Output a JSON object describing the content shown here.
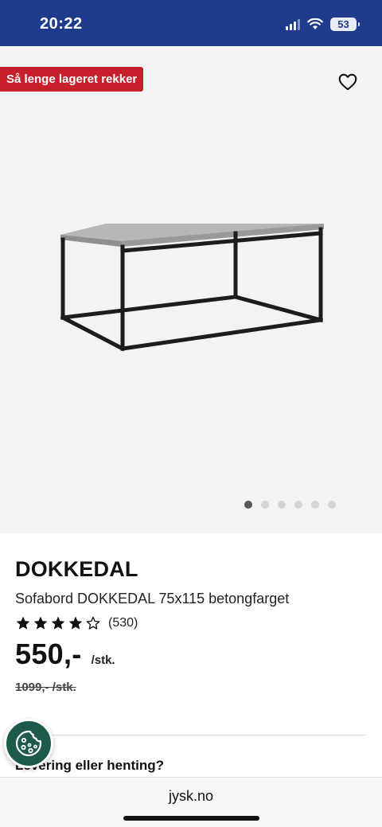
{
  "status_bar": {
    "time": "20:22",
    "battery": "53"
  },
  "badge": {
    "text": "Så lenge lageret rekker"
  },
  "gallery": {
    "slide_count": 6,
    "active_slide": 1
  },
  "product": {
    "brand": "DOKKEDAL",
    "title": "Sofabord DOKKEDAL 75x115 betongfarget",
    "rating": 4,
    "rating_max": 5,
    "review_count": "(530)",
    "price": "550,-",
    "unit": "/stk.",
    "old_price": "1099,- /stk."
  },
  "delivery": {
    "heading": "Levering eller henting?"
  },
  "browser": {
    "url": "jysk.no"
  },
  "colors": {
    "brand_blue": "#1f3b8c",
    "badge_red": "#c8202b",
    "cookie_green": "#1d5a4b"
  }
}
